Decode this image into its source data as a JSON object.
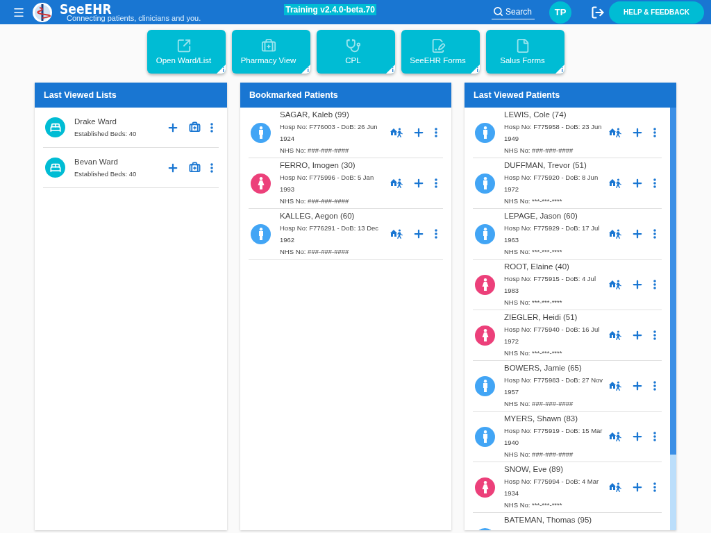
{
  "app_bar": {
    "logo": "SeeEHR",
    "tagline": "Connecting patients, clinicians and you.",
    "version": "Training v2.4.0-beta.70",
    "search": {
      "label": "Search"
    },
    "avatar": "TP",
    "help_button": "HELP & FEEDBACK"
  },
  "tiles": [
    {
      "kind": "open",
      "label": "Open Ward/List",
      "info": "i"
    },
    {
      "kind": "pharmacy",
      "label": "Pharmacy View",
      "info": "i"
    },
    {
      "kind": "cpl",
      "label": "CPL",
      "info": "i"
    },
    {
      "kind": "forms",
      "label": "SeeEHR Forms",
      "info": "i"
    },
    {
      "kind": "file",
      "label": "Salus Forms",
      "info": "i"
    }
  ],
  "last_viewed_lists": {
    "title": "Last Viewed Lists",
    "items": [
      {
        "name": "Drake Ward",
        "beds": "Established Beds: 40"
      },
      {
        "name": "Bevan Ward",
        "beds": "Established Beds: 40"
      }
    ]
  },
  "bookmarked_patients": {
    "title": "Bookmarked Patients",
    "items": [
      {
        "kind": "male",
        "name": "SAGAR, Kaleb (99)",
        "hosp": "Hosp No: F776003 - DoB: 26 Jun 1924",
        "nhs": "NHS No: ###-###-####"
      },
      {
        "kind": "female",
        "name": "FERRO, Imogen (30)",
        "hosp": "Hosp No: F775996 - DoB: 5 Jan 1993",
        "nhs": "NHS No: ###-###-####"
      },
      {
        "kind": "male",
        "name": "KALLEG, Aegon (60)",
        "hosp": "Hosp No: F776291 - DoB: 13 Dec 1962",
        "nhs": "NHS No: ###-###-####"
      }
    ]
  },
  "last_viewed_patients": {
    "title": "Last Viewed Patients",
    "items": [
      {
        "kind": "male",
        "name": "LEWIS, Cole (74)",
        "hosp": "Hosp No: F775958 - DoB: 23 Jun 1949",
        "nhs": "NHS No: ###-###-####"
      },
      {
        "kind": "male",
        "name": "DUFFMAN, Trevor (51)",
        "hosp": "Hosp No: F775920 - DoB: 8 Jun 1972",
        "nhs": "NHS No: ***-***-****"
      },
      {
        "kind": "male",
        "name": "LEPAGE, Jason (60)",
        "hosp": "Hosp No: F775929 - DoB: 17 Jul 1963",
        "nhs": "NHS No: ***-***-****"
      },
      {
        "kind": "female",
        "name": "ROOT, Elaine (40)",
        "hosp": "Hosp No: F775915 - DoB: 4 Jul 1983",
        "nhs": "NHS No: ***-***-****"
      },
      {
        "kind": "female",
        "name": "ZIEGLER, Heidi (51)",
        "hosp": "Hosp No: F775940 - DoB: 16 Jul 1972",
        "nhs": "NHS No: ***-***-****"
      },
      {
        "kind": "male",
        "name": "BOWERS, Jamie (65)",
        "hosp": "Hosp No: F775983 - DoB: 27 Nov 1957",
        "nhs": "NHS No: ###-###-####"
      },
      {
        "kind": "male",
        "name": "MYERS, Shawn (83)",
        "hosp": "Hosp No: F775919 - DoB: 15 Mar 1940",
        "nhs": "NHS No: ###-###-####"
      },
      {
        "kind": "female",
        "name": "SNOW, Eve (89)",
        "hosp": "Hosp No: F775994 - DoB: 4 Mar 1934",
        "nhs": "NHS No: ***-***-****"
      },
      {
        "kind": "male",
        "name": "BATEMAN, Thomas (95)"
      }
    ]
  }
}
